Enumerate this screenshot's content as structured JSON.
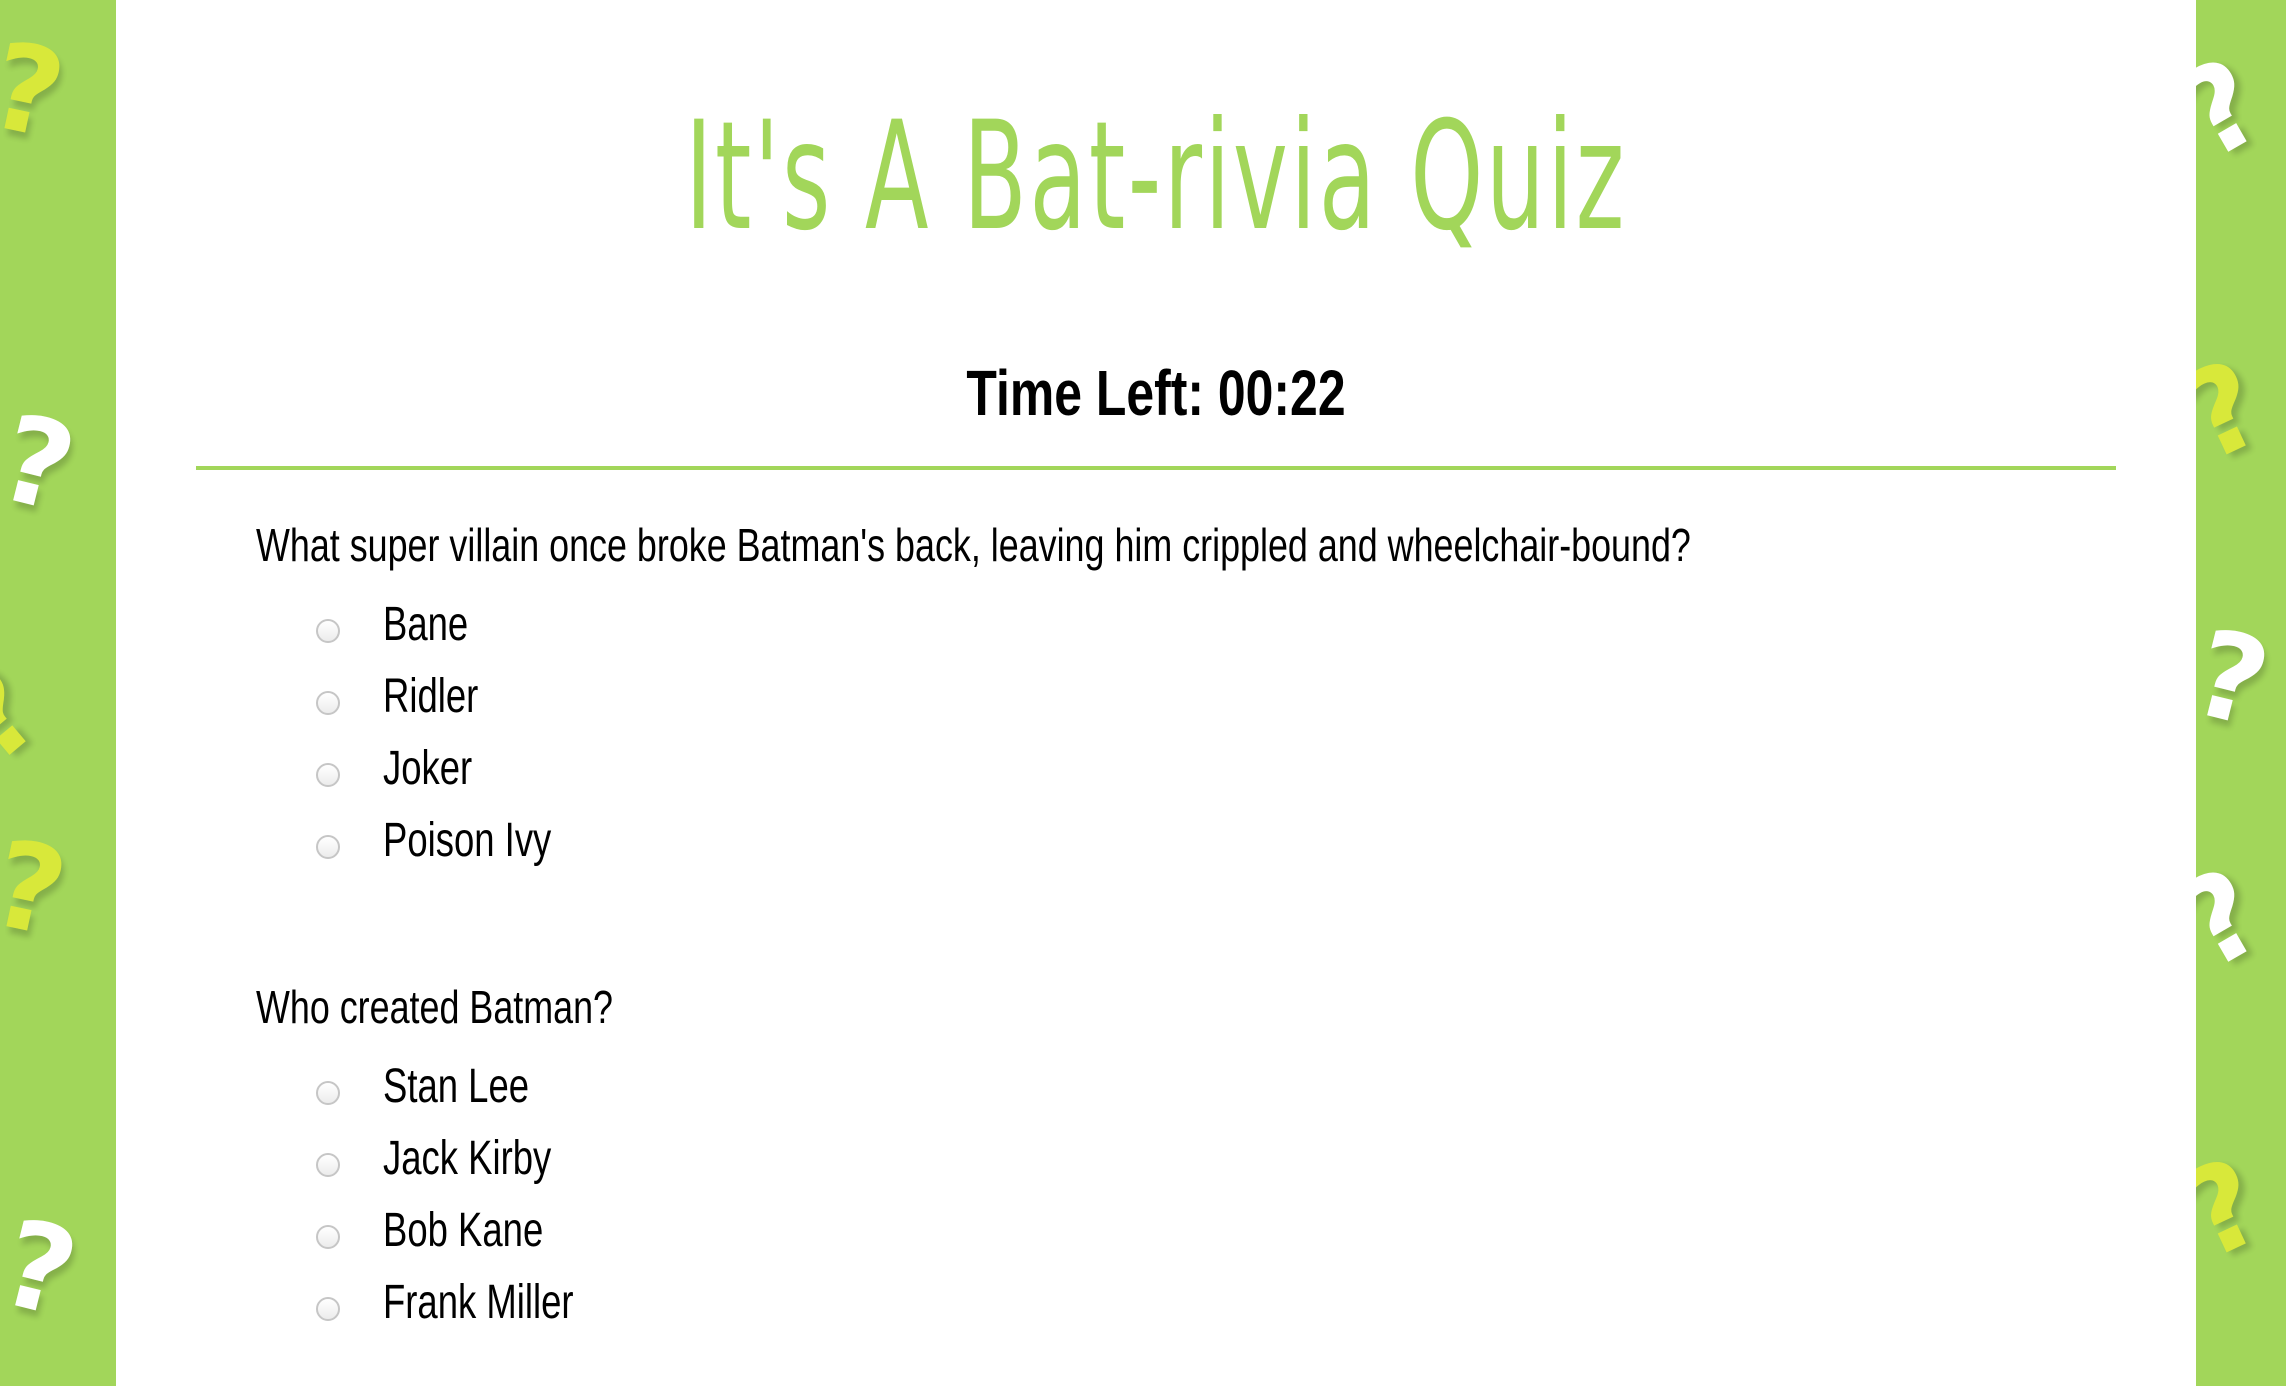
{
  "page": {
    "title": "It's A Bat-rivia Quiz",
    "timer": "Time Left: 00:22",
    "colors": {
      "accent": "#a2d65a",
      "background": "#a2d65a",
      "panel": "#ffffff",
      "text": "#000000",
      "qmark_white": "#ffffff",
      "qmark_yellow": "#d8e83a"
    },
    "background_icon": "question-mark-icon"
  },
  "questions": [
    {
      "text": "What super villain once broke Batman's back, leaving him crippled and wheelchair-bound?",
      "options": [
        "Bane",
        "Ridler",
        "Joker",
        "Poison Ivy"
      ]
    },
    {
      "text": "Who created Batman?",
      "options": [
        "Stan Lee",
        "Jack Kirby",
        "Bob Kane",
        "Frank Miller"
      ]
    }
  ]
}
